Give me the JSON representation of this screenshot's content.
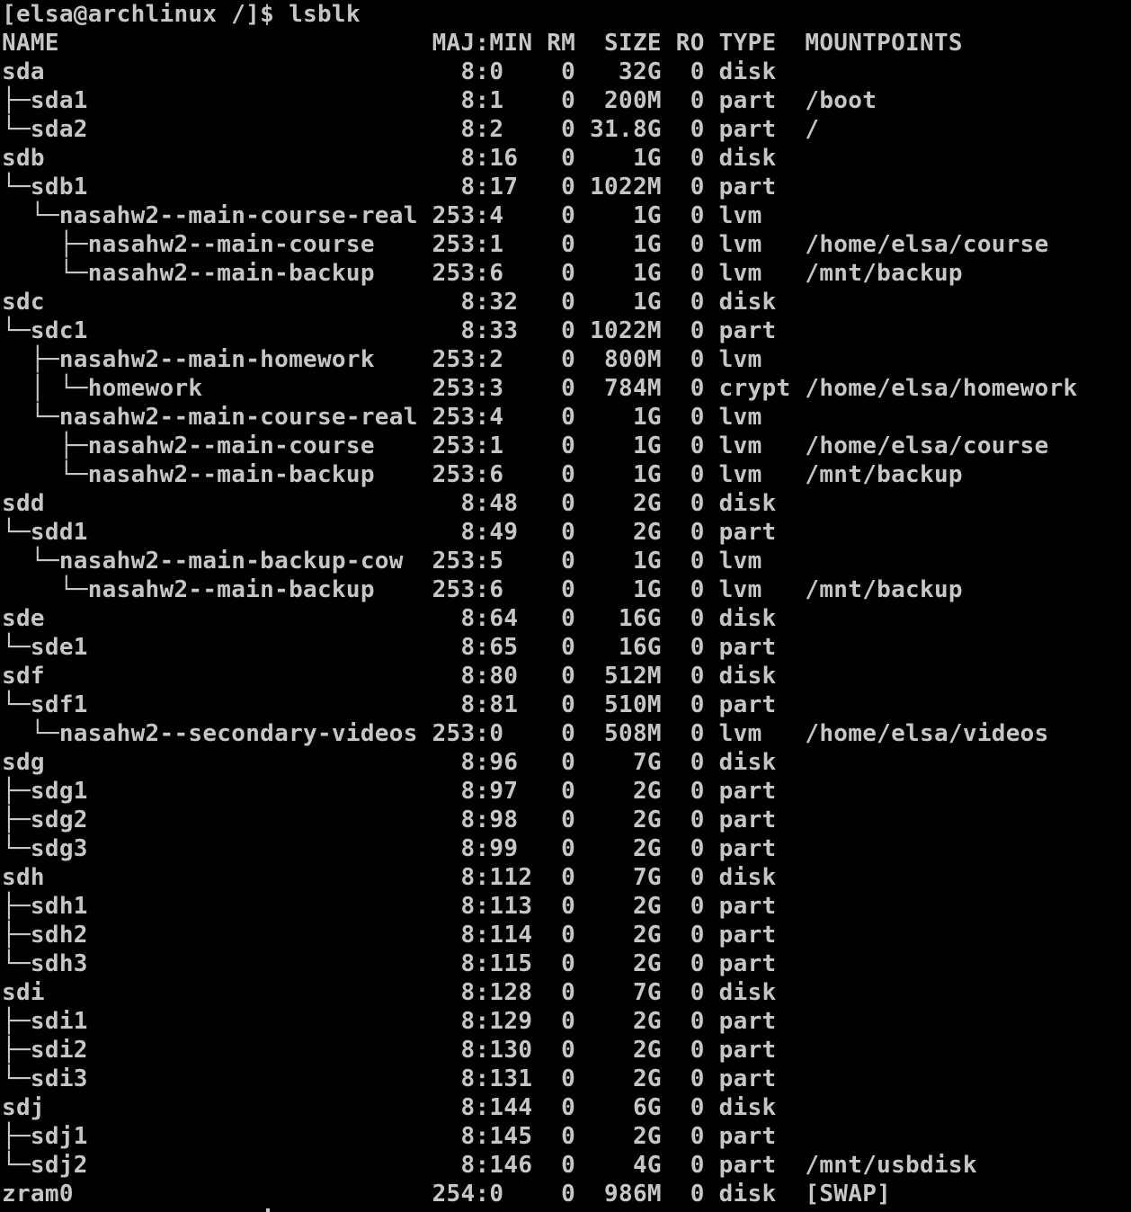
{
  "terminal": {
    "prompt": "[elsa@archlinux /]$ lsblk",
    "header": "NAME                          MAJ:MIN RM  SIZE RO TYPE  MOUNTPOINTS",
    "lines": [
      "sda                             8:0    0   32G  0 disk",
      "├─sda1                          8:1    0  200M  0 part  /boot",
      "└─sda2                          8:2    0 31.8G  0 part  /",
      "sdb                             8:16   0    1G  0 disk",
      "└─sdb1                          8:17   0 1022M  0 part",
      "  └─nasahw2--main-course-real 253:4    0    1G  0 lvm",
      "    ├─nasahw2--main-course    253:1    0    1G  0 lvm   /home/elsa/course",
      "    └─nasahw2--main-backup    253:6    0    1G  0 lvm   /mnt/backup",
      "sdc                             8:32   0    1G  0 disk",
      "└─sdc1                          8:33   0 1022M  0 part",
      "  ├─nasahw2--main-homework    253:2    0  800M  0 lvm",
      "  │ └─homework                253:3    0  784M  0 crypt /home/elsa/homework",
      "  └─nasahw2--main-course-real 253:4    0    1G  0 lvm",
      "    ├─nasahw2--main-course    253:1    0    1G  0 lvm   /home/elsa/course",
      "    └─nasahw2--main-backup    253:6    0    1G  0 lvm   /mnt/backup",
      "sdd                             8:48   0    2G  0 disk",
      "└─sdd1                          8:49   0    2G  0 part",
      "  └─nasahw2--main-backup-cow  253:5    0    1G  0 lvm",
      "    └─nasahw2--main-backup    253:6    0    1G  0 lvm   /mnt/backup",
      "sde                             8:64   0   16G  0 disk",
      "└─sde1                          8:65   0   16G  0 part",
      "sdf                             8:80   0  512M  0 disk",
      "└─sdf1                          8:81   0  510M  0 part",
      "  └─nasahw2--secondary-videos 253:0    0  508M  0 lvm   /home/elsa/videos",
      "sdg                             8:96   0    7G  0 disk",
      "├─sdg1                          8:97   0    2G  0 part",
      "├─sdg2                          8:98   0    2G  0 part",
      "└─sdg3                          8:99   0    2G  0 part",
      "sdh                             8:112  0    7G  0 disk",
      "├─sdh1                          8:113  0    2G  0 part",
      "├─sdh2                          8:114  0    2G  0 part",
      "└─sdh3                          8:115  0    2G  0 part",
      "sdi                             8:128  0    7G  0 disk",
      "├─sdi1                          8:129  0    2G  0 part",
      "├─sdi2                          8:130  0    2G  0 part",
      "└─sdi3                          8:131  0    2G  0 part",
      "sdj                             8:144  0    6G  0 disk",
      "├─sdj1                          8:145  0    2G  0 part",
      "└─sdj2                          8:146  0    4G  0 part  /mnt/usbdisk",
      "zram0                         254:0    0  986M  0 disk  [SWAP]"
    ]
  },
  "colors": {
    "background": "#000000",
    "foreground": "#c6c6c6"
  }
}
